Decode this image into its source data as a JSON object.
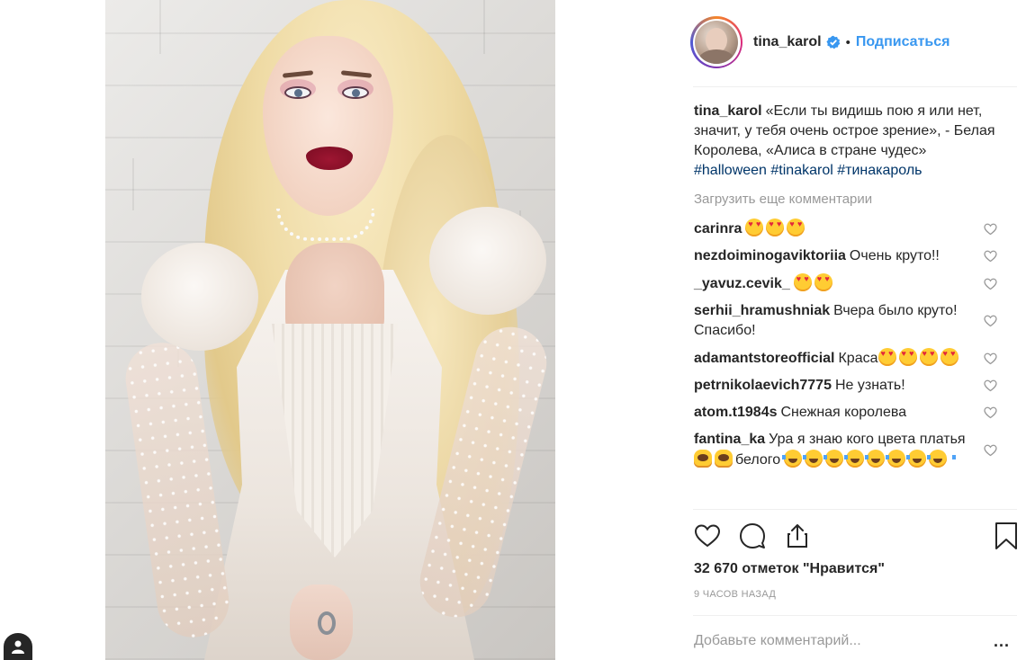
{
  "post": {
    "author": "tina_karol",
    "follow_label": "Подписаться",
    "dot": "•",
    "caption": {
      "username": "tina_karol",
      "text": "«Если ты видишь пою я или нет, значит, у тебя очень острое зрение», - Белая Королева, «Алиса в стране чудес»",
      "hashtags": [
        "#halloween",
        "#tinakarol",
        "#тинакароль"
      ]
    },
    "load_more_label": "Загрузить еще комментарии",
    "comments": [
      {
        "username": "carinra",
        "text": "",
        "emojis": [
          "love",
          "love",
          "love"
        ]
      },
      {
        "username": "nezdoiminogaviktoriia",
        "text": "Очень круто!!",
        "emojis": []
      },
      {
        "username": "_yavuz.cevik_",
        "text": "",
        "emojis": [
          "love",
          "love"
        ]
      },
      {
        "username": "serhii_hramushniak",
        "text": "Вчера было круто! Спасибо!",
        "emojis": []
      },
      {
        "username": "adamantstoreofficial",
        "text": "Краса",
        "emojis": [
          "love",
          "love",
          "love",
          "love"
        ]
      },
      {
        "username": "petrnikolaevich7775",
        "text": "Не узнать!",
        "emojis": []
      },
      {
        "username": "atom.t1984s",
        "text": "Снежная королева",
        "emojis": []
      },
      {
        "username": "fantina_ka",
        "text": "Ура я знаю кого цвета платья",
        "text_after": "белого",
        "emojis": [
          "hands",
          "hands"
        ],
        "emojis_after": [
          "cry",
          "cry",
          "cry",
          "cry",
          "cry",
          "cry",
          "cry",
          "cry"
        ]
      }
    ],
    "likes_label": "32 670 отметок \"Нравится\"",
    "time_label": "9 часов назад",
    "add_comment_placeholder": "Добавьте комментарий...",
    "more_label": "..."
  },
  "colors": {
    "link_blue": "#3897f0",
    "hashtag_blue": "#003569",
    "muted_gray": "#999999",
    "text": "#262626"
  },
  "icons": {
    "verified": "verified-badge-icon",
    "like": "heart-icon",
    "comment": "comment-bubble-icon",
    "share": "share-icon",
    "save": "bookmark-icon",
    "tag": "user-tag-icon"
  }
}
